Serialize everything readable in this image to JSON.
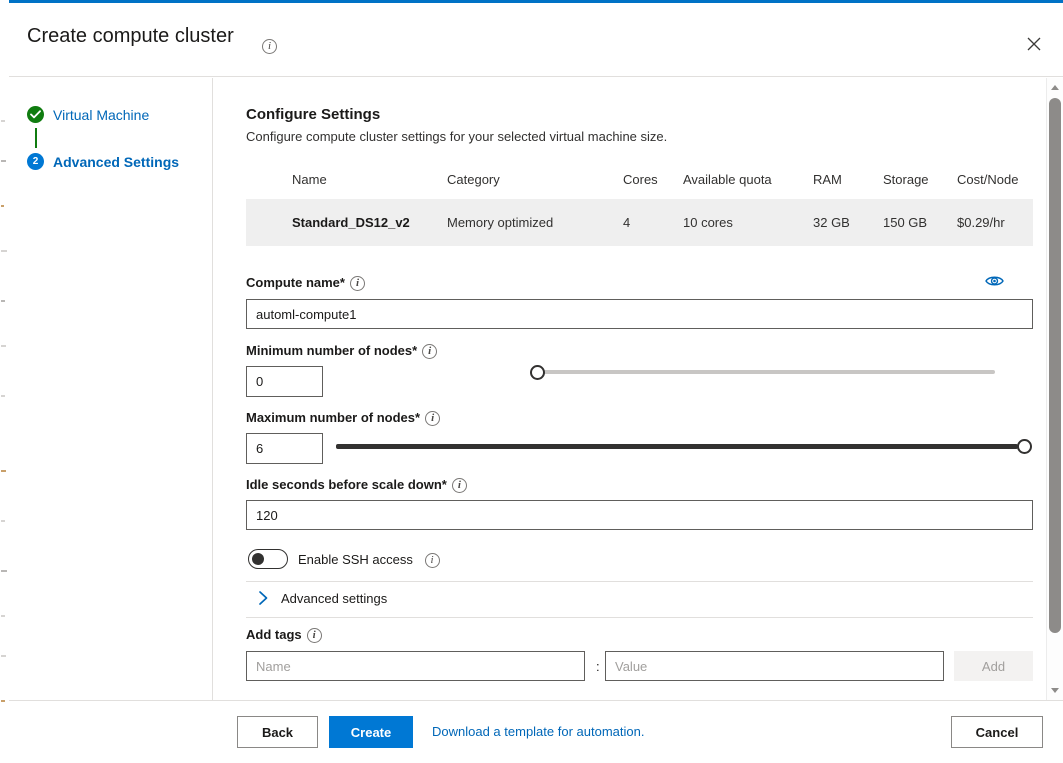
{
  "dialog": {
    "title": "Create compute cluster",
    "title_info_icon": "info-icon",
    "close_icon": "close-icon",
    "accent_color": "#0072c6"
  },
  "wizard": {
    "steps": [
      {
        "label": "Virtual Machine",
        "marker": "check-icon",
        "state": "completed",
        "color": "#107c10"
      },
      {
        "label": "Advanced Settings",
        "marker": "2",
        "state": "current",
        "color": "#0078d4"
      }
    ]
  },
  "pane": {
    "heading": "Configure Settings",
    "subheading": "Configure compute cluster settings for your selected virtual machine size."
  },
  "vm_table": {
    "columns": [
      "Name",
      "Category",
      "Cores",
      "Available quota",
      "RAM",
      "Storage",
      "Cost/Node"
    ],
    "rows": [
      {
        "name": "Standard_DS12_v2",
        "category": "Memory optimized",
        "cores": "4",
        "available_quota": "10 cores",
        "ram": "32 GB",
        "storage": "150 GB",
        "cost_node": "$0.29/hr"
      }
    ]
  },
  "form": {
    "compute_name": {
      "label": "Compute name",
      "required_mark": "*",
      "value": "automl-compute1",
      "placeholder": "",
      "reveal_icon": "eye-icon"
    },
    "min_nodes": {
      "label": "Minimum number of nodes",
      "required_mark": "*",
      "value": "0",
      "slider_percent": 0
    },
    "max_nodes": {
      "label": "Maximum number of nodes",
      "required_mark": "*",
      "value": "6",
      "slider_percent": 100
    },
    "idle_seconds": {
      "label": "Idle seconds before scale down",
      "required_mark": "*",
      "value": "120"
    },
    "ssh": {
      "label": "Enable SSH access",
      "enabled": false
    },
    "advanced_settings": {
      "label": "Advanced settings",
      "expanded": false,
      "chevron_icon": "chevron-right-icon"
    },
    "add_tags": {
      "label": "Add tags",
      "name_placeholder": "Name",
      "name_value": "",
      "separator": ":",
      "value_placeholder": "Value",
      "value_value": "",
      "add_label": "Add",
      "add_disabled": true
    }
  },
  "footer": {
    "back_label": "Back",
    "create_label": "Create",
    "template_link": "Download a template for automation.",
    "cancel_label": "Cancel"
  },
  "scrollbar": {
    "up_icon": "scroll-up-arrow-icon",
    "down_icon": "scroll-down-arrow-icon"
  }
}
